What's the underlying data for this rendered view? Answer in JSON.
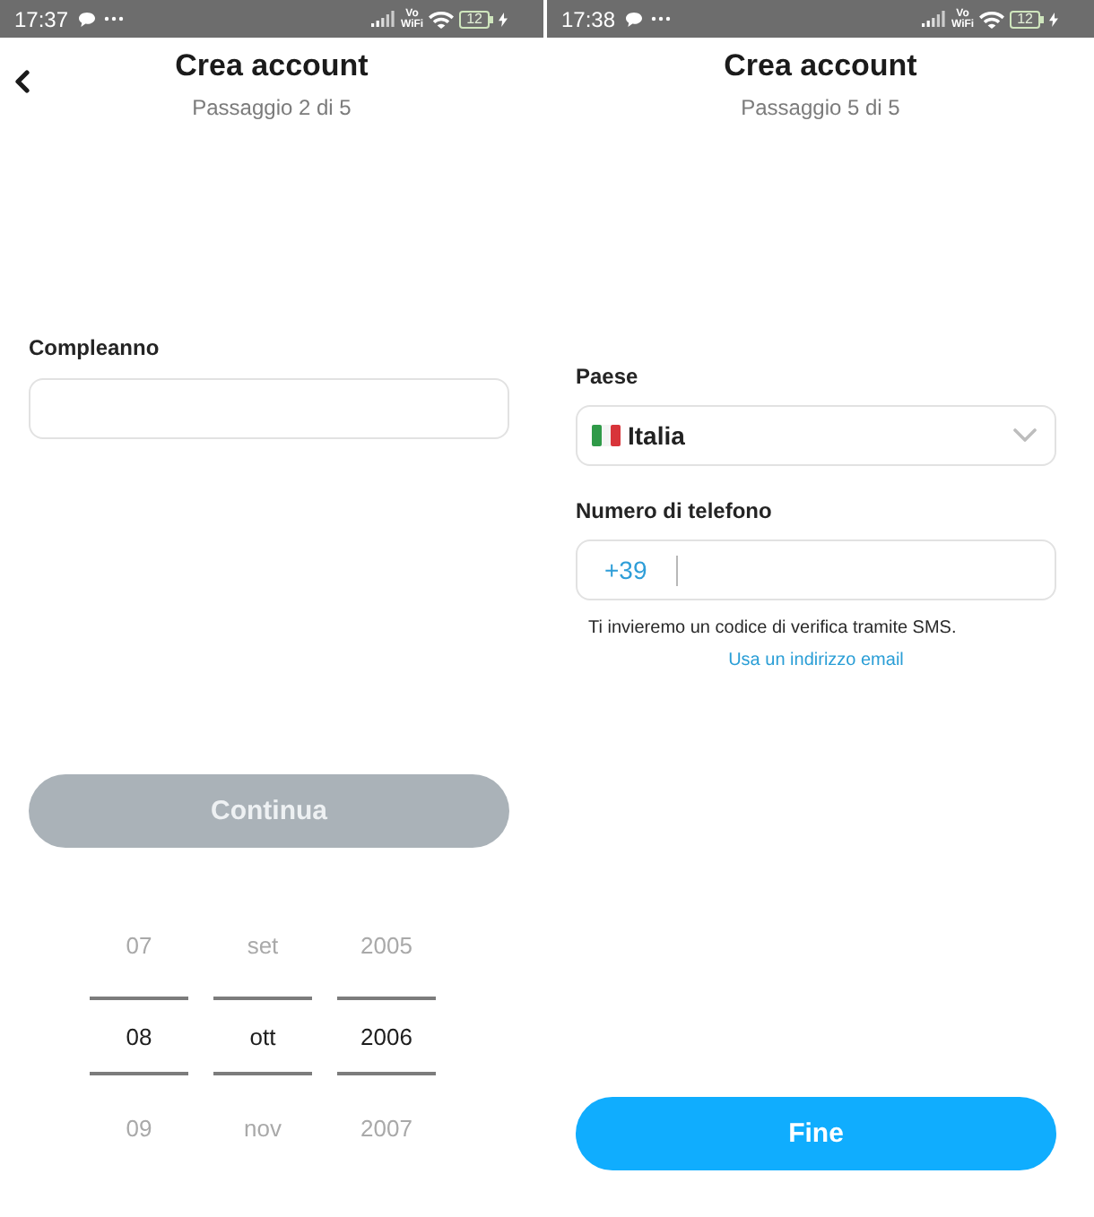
{
  "screens": [
    {
      "kind": "birthday",
      "status_bar": {
        "time": "17:37",
        "network_top": "Vo",
        "network_bottom": "WiFi",
        "battery": "12"
      },
      "header": {
        "back_button": true,
        "title": "Crea account",
        "subtitle": "Passaggio 2 di 5"
      },
      "birthday_field": {
        "label": "Compleanno"
      },
      "primary_button": {
        "label": "Continua",
        "disabled": true
      },
      "date_picker": {
        "columns": [
          {
            "items": [
              {
                "label": "07",
                "selected": false
              },
              {
                "label": "08",
                "selected": true
              },
              {
                "label": "09",
                "selected": false
              }
            ]
          },
          {
            "items": [
              {
                "label": "set",
                "selected": false
              },
              {
                "label": "ott",
                "selected": true
              },
              {
                "label": "nov",
                "selected": false
              }
            ]
          },
          {
            "items": [
              {
                "label": "2005",
                "selected": false
              },
              {
                "label": "2006",
                "selected": true
              },
              {
                "label": "2007",
                "selected": false
              }
            ]
          }
        ]
      }
    },
    {
      "kind": "phone",
      "status_bar": {
        "time": "17:38",
        "network_top": "Vo",
        "network_bottom": "WiFi",
        "battery": "12"
      },
      "header": {
        "title": "Crea account",
        "subtitle": "Passaggio 5 di 5"
      },
      "country_select": {
        "label": "Paese",
        "value": "Italia"
      },
      "phone_field": {
        "label": "Numero di telefono",
        "prefix": "+39"
      },
      "hint": "Ti invieremo un codice di verifica tramite SMS.",
      "email_link": "Usa un indirizzo email",
      "primary_button": {
        "label": "Fine",
        "disabled": false
      }
    }
  ]
}
